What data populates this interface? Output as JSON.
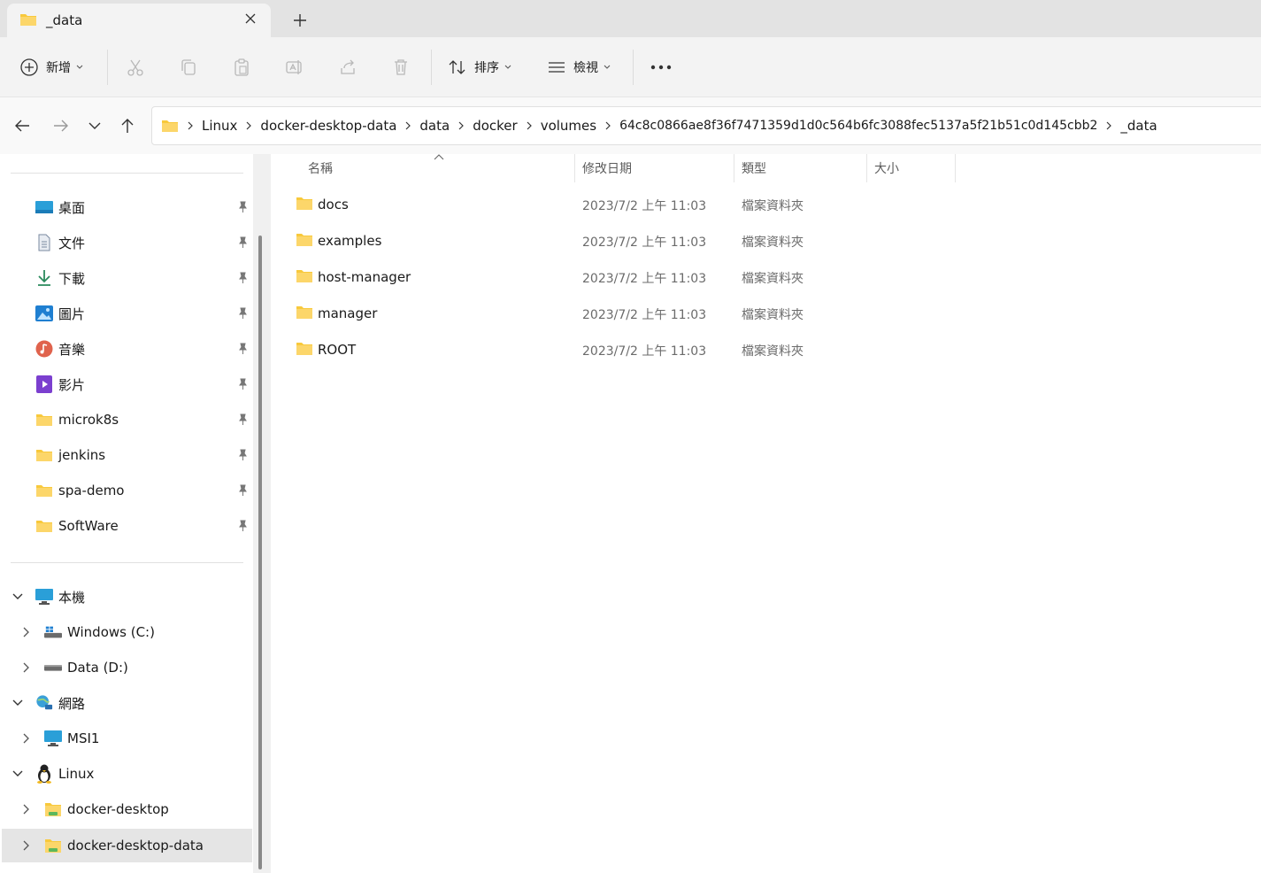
{
  "window": {
    "tab_title": "_data"
  },
  "toolbar": {
    "new_label": "新增",
    "sort_label": "排序",
    "view_label": "檢視"
  },
  "breadcrumb": [
    "Linux",
    "docker-desktop-data",
    "data",
    "docker",
    "volumes",
    "64c8c0866ae8f36f7471359d1d0c564b6fc3088fec5137a5f21b51c0d145cbb2",
    "_data"
  ],
  "sidebar": {
    "quick_access": [
      {
        "label": "桌面",
        "icon": "desktop-icon",
        "pinned": true
      },
      {
        "label": "文件",
        "icon": "documents-icon",
        "pinned": true
      },
      {
        "label": "下載",
        "icon": "download-icon",
        "pinned": true
      },
      {
        "label": "圖片",
        "icon": "pictures-icon",
        "pinned": true
      },
      {
        "label": "音樂",
        "icon": "music-icon",
        "pinned": true
      },
      {
        "label": "影片",
        "icon": "videos-icon",
        "pinned": true
      },
      {
        "label": "microk8s",
        "icon": "folder-icon",
        "pinned": true
      },
      {
        "label": "jenkins",
        "icon": "folder-icon",
        "pinned": true
      },
      {
        "label": "spa-demo",
        "icon": "folder-icon",
        "pinned": true
      },
      {
        "label": "SoftWare",
        "icon": "folder-icon",
        "pinned": true
      }
    ],
    "tree": [
      {
        "label": "本機",
        "icon": "computer-icon",
        "expanded": true
      },
      {
        "label": "Windows (C:)",
        "icon": "windows-drive-icon",
        "expanded": false
      },
      {
        "label": "Data (D:)",
        "icon": "drive-icon",
        "expanded": false
      },
      {
        "label": "網路",
        "icon": "network-icon",
        "expanded": true
      },
      {
        "label": "MSI1",
        "icon": "monitor-icon",
        "expanded": false
      },
      {
        "label": "Linux",
        "icon": "linux-penguin-icon",
        "expanded": true
      },
      {
        "label": "docker-desktop",
        "icon": "linux-folder-icon",
        "expanded": false
      },
      {
        "label": "docker-desktop-data",
        "icon": "linux-folder-icon",
        "expanded": false,
        "selected": true
      }
    ]
  },
  "filelist": {
    "columns": {
      "name": "名稱",
      "modified": "修改日期",
      "type": "類型",
      "size": "大小"
    },
    "rows": [
      {
        "name": "docs",
        "modified": "2023/7/2 上午 11:03",
        "type": "檔案資料夾"
      },
      {
        "name": "examples",
        "modified": "2023/7/2 上午 11:03",
        "type": "檔案資料夾"
      },
      {
        "name": "host-manager",
        "modified": "2023/7/2 上午 11:03",
        "type": "檔案資料夾"
      },
      {
        "name": "manager",
        "modified": "2023/7/2 上午 11:03",
        "type": "檔案資料夾"
      },
      {
        "name": "ROOT",
        "modified": "2023/7/2 上午 11:03",
        "type": "檔案資料夾"
      }
    ]
  },
  "colors": {
    "folder_yellow": "#f8c93c",
    "selection_bg": "#e5e5e5",
    "accent_blue": "#0067c0"
  }
}
